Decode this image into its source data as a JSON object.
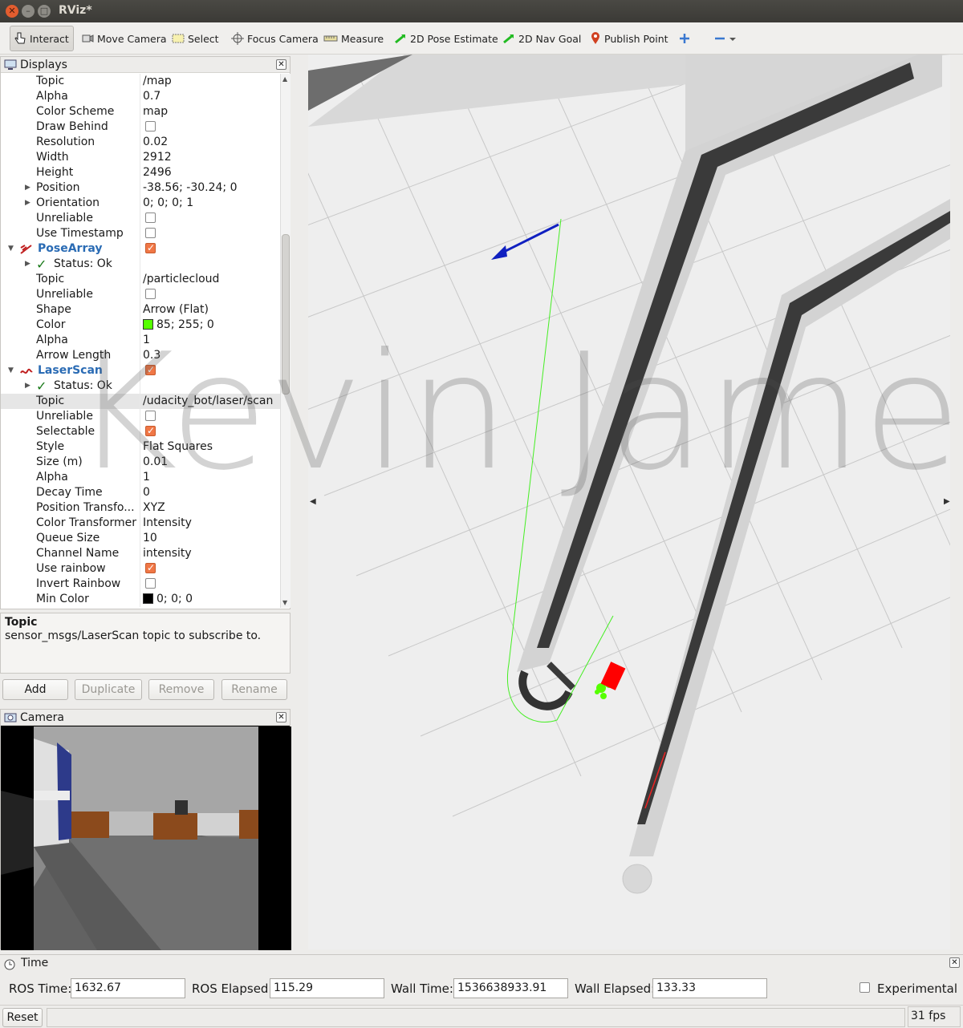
{
  "window": {
    "title": "RViz*"
  },
  "toolbar": {
    "interact": "Interact",
    "move_camera": "Move Camera",
    "select": "Select",
    "focus_camera": "Focus Camera",
    "measure": "Measure",
    "pose_estimate": "2D Pose Estimate",
    "nav_goal": "2D Nav Goal",
    "publish_point": "Publish Point"
  },
  "displays": {
    "title": "Displays",
    "rows": [
      {
        "name": "Topic",
        "value": "/map"
      },
      {
        "name": "Alpha",
        "value": "0.7"
      },
      {
        "name": "Color Scheme",
        "value": "map"
      },
      {
        "name": "Draw Behind",
        "checkbox": false
      },
      {
        "name": "Resolution",
        "value": "0.02"
      },
      {
        "name": "Width",
        "value": "2912"
      },
      {
        "name": "Height",
        "value": "2496"
      },
      {
        "name": "Position",
        "value": "-38.56; -30.24; 0",
        "expand": true
      },
      {
        "name": "Orientation",
        "value": "0; 0; 0; 1",
        "expand": true
      },
      {
        "name": "Unreliable",
        "checkbox": false
      },
      {
        "name": "Use Timestamp",
        "checkbox": false
      },
      {
        "name": "PoseArray",
        "checkbox": true,
        "level1": true,
        "icon": "pose-array-icon"
      },
      {
        "name": "Status: Ok",
        "status": true,
        "expand": true
      },
      {
        "name": "Topic",
        "value": "/particlecloud"
      },
      {
        "name": "Unreliable",
        "checkbox": false
      },
      {
        "name": "Shape",
        "value": "Arrow (Flat)"
      },
      {
        "name": "Color",
        "value": "85; 255; 0",
        "swatch": "#55ff00"
      },
      {
        "name": "Alpha",
        "value": "1"
      },
      {
        "name": "Arrow Length",
        "value": "0.3"
      },
      {
        "name": "LaserScan",
        "checkbox": true,
        "level1": true,
        "icon": "laser-scan-icon"
      },
      {
        "name": "Status: Ok",
        "status": true,
        "expand": true
      },
      {
        "name": "Topic",
        "value": "/udacity_bot/laser/scan",
        "selected": true
      },
      {
        "name": "Unreliable",
        "checkbox": false
      },
      {
        "name": "Selectable",
        "checkbox": true
      },
      {
        "name": "Style",
        "value": "Flat Squares"
      },
      {
        "name": "Size (m)",
        "value": "0.01"
      },
      {
        "name": "Alpha",
        "value": "1"
      },
      {
        "name": "Decay Time",
        "value": "0"
      },
      {
        "name": "Position Transfo...",
        "value": "XYZ"
      },
      {
        "name": "Color Transformer",
        "value": "Intensity"
      },
      {
        "name": "Queue Size",
        "value": "10"
      },
      {
        "name": "Channel Name",
        "value": "intensity"
      },
      {
        "name": "Use rainbow",
        "checkbox": true
      },
      {
        "name": "Invert Rainbow",
        "checkbox": false
      },
      {
        "name": "Min Color",
        "value": "0; 0; 0",
        "swatch": "#000000"
      }
    ]
  },
  "description": {
    "title": "Topic",
    "text": "sensor_msgs/LaserScan topic to subscribe to."
  },
  "buttons": {
    "add": "Add",
    "duplicate": "Duplicate",
    "remove": "Remove",
    "rename": "Rename"
  },
  "camera": {
    "title": "Camera"
  },
  "watermark": "Kevin James",
  "time": {
    "title": "Time",
    "ros_time_label": "ROS Time:",
    "ros_time": "1632.67",
    "ros_elapsed_label": "ROS Elapsed:",
    "ros_elapsed": "115.29",
    "wall_time_label": "Wall Time:",
    "wall_time": "1536638933.91",
    "wall_elapsed_label": "Wall Elapsed:",
    "wall_elapsed": "133.33",
    "experimental": "Experimental"
  },
  "status": {
    "reset": "Reset",
    "fps": "31 fps"
  },
  "colors": {
    "particles": "#55ff00",
    "goal_arrow": "#1020c0",
    "robot": "#ff0000"
  }
}
